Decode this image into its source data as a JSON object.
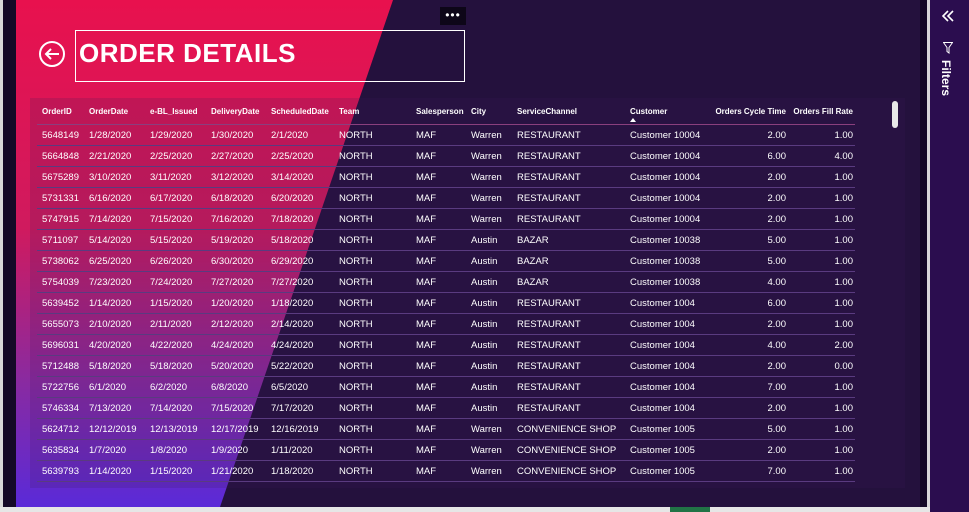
{
  "header": {
    "title": "ORDER DETAILS",
    "more_options": "•••"
  },
  "filters_pane": {
    "label": "Filters"
  },
  "table": {
    "columns": [
      {
        "key": "OrderID",
        "label": "OrderID"
      },
      {
        "key": "OrderDate",
        "label": "OrderDate"
      },
      {
        "key": "eBL",
        "label": "e-BL_Issued"
      },
      {
        "key": "DeliveryDate",
        "label": "DeliveryDate"
      },
      {
        "key": "ScheduledDate",
        "label": "ScheduledDate"
      },
      {
        "key": "Team",
        "label": "Team"
      },
      {
        "key": "Salesperson",
        "label": "Salesperson"
      },
      {
        "key": "City",
        "label": "City"
      },
      {
        "key": "ServiceChannel",
        "label": "ServiceChannel"
      },
      {
        "key": "Customer",
        "label": "Customer"
      },
      {
        "key": "CycleTime",
        "label": "Orders Cycle Time"
      },
      {
        "key": "FillRate",
        "label": "Orders Fill Rate"
      }
    ],
    "sorted_column": "Customer",
    "rows": [
      [
        "5648149",
        "1/28/2020",
        "1/29/2020",
        "1/30/2020",
        "2/1/2020",
        "NORTH",
        "MAF",
        "Warren",
        "RESTAURANT",
        "Customer 10004",
        "2.00",
        "1.00"
      ],
      [
        "5664848",
        "2/21/2020",
        "2/25/2020",
        "2/27/2020",
        "2/25/2020",
        "NORTH",
        "MAF",
        "Warren",
        "RESTAURANT",
        "Customer 10004",
        "6.00",
        "4.00"
      ],
      [
        "5675289",
        "3/10/2020",
        "3/11/2020",
        "3/12/2020",
        "3/14/2020",
        "NORTH",
        "MAF",
        "Warren",
        "RESTAURANT",
        "Customer 10004",
        "2.00",
        "1.00"
      ],
      [
        "5731331",
        "6/16/2020",
        "6/17/2020",
        "6/18/2020",
        "6/20/2020",
        "NORTH",
        "MAF",
        "Warren",
        "RESTAURANT",
        "Customer 10004",
        "2.00",
        "1.00"
      ],
      [
        "5747915",
        "7/14/2020",
        "7/15/2020",
        "7/16/2020",
        "7/18/2020",
        "NORTH",
        "MAF",
        "Warren",
        "RESTAURANT",
        "Customer 10004",
        "2.00",
        "1.00"
      ],
      [
        "5711097",
        "5/14/2020",
        "5/15/2020",
        "5/19/2020",
        "5/18/2020",
        "NORTH",
        "MAF",
        "Austin",
        "BAZAR",
        "Customer 10038",
        "5.00",
        "1.00"
      ],
      [
        "5738062",
        "6/25/2020",
        "6/26/2020",
        "6/30/2020",
        "6/29/2020",
        "NORTH",
        "MAF",
        "Austin",
        "BAZAR",
        "Customer 10038",
        "5.00",
        "1.00"
      ],
      [
        "5754039",
        "7/23/2020",
        "7/24/2020",
        "7/27/2020",
        "7/27/2020",
        "NORTH",
        "MAF",
        "Austin",
        "BAZAR",
        "Customer 10038",
        "4.00",
        "1.00"
      ],
      [
        "5639452",
        "1/14/2020",
        "1/15/2020",
        "1/20/2020",
        "1/18/2020",
        "NORTH",
        "MAF",
        "Austin",
        "RESTAURANT",
        "Customer 1004",
        "6.00",
        "1.00"
      ],
      [
        "5655073",
        "2/10/2020",
        "2/11/2020",
        "2/12/2020",
        "2/14/2020",
        "NORTH",
        "MAF",
        "Austin",
        "RESTAURANT",
        "Customer 1004",
        "2.00",
        "1.00"
      ],
      [
        "5696031",
        "4/20/2020",
        "4/22/2020",
        "4/24/2020",
        "4/24/2020",
        "NORTH",
        "MAF",
        "Austin",
        "RESTAURANT",
        "Customer 1004",
        "4.00",
        "2.00"
      ],
      [
        "5712488",
        "5/18/2020",
        "5/18/2020",
        "5/20/2020",
        "5/22/2020",
        "NORTH",
        "MAF",
        "Austin",
        "RESTAURANT",
        "Customer 1004",
        "2.00",
        "0.00"
      ],
      [
        "5722756",
        "6/1/2020",
        "6/2/2020",
        "6/8/2020",
        "6/5/2020",
        "NORTH",
        "MAF",
        "Austin",
        "RESTAURANT",
        "Customer 1004",
        "7.00",
        "1.00"
      ],
      [
        "5746334",
        "7/13/2020",
        "7/14/2020",
        "7/15/2020",
        "7/17/2020",
        "NORTH",
        "MAF",
        "Austin",
        "RESTAURANT",
        "Customer 1004",
        "2.00",
        "1.00"
      ],
      [
        "5624712",
        "12/12/2019",
        "12/13/2019",
        "12/17/2019",
        "12/16/2019",
        "NORTH",
        "MAF",
        "Warren",
        "CONVENIENCE SHOP",
        "Customer 1005",
        "5.00",
        "1.00"
      ],
      [
        "5635834",
        "1/7/2020",
        "1/8/2020",
        "1/9/2020",
        "1/11/2020",
        "NORTH",
        "MAF",
        "Warren",
        "CONVENIENCE SHOP",
        "Customer 1005",
        "2.00",
        "1.00"
      ],
      [
        "5639793",
        "1/14/2020",
        "1/15/2020",
        "1/21/2020",
        "1/18/2020",
        "NORTH",
        "MAF",
        "Warren",
        "CONVENIENCE SHOP",
        "Customer 1005",
        "7.00",
        "1.00"
      ]
    ]
  },
  "colors": {
    "accent_red": "#e8114e",
    "accent_purple": "#5a2ad8",
    "background": "#24113d"
  },
  "icons": {
    "back": "back-arrow-circle-icon",
    "collapse": "double-chevron-left-icon",
    "filter": "funnel-icon"
  }
}
